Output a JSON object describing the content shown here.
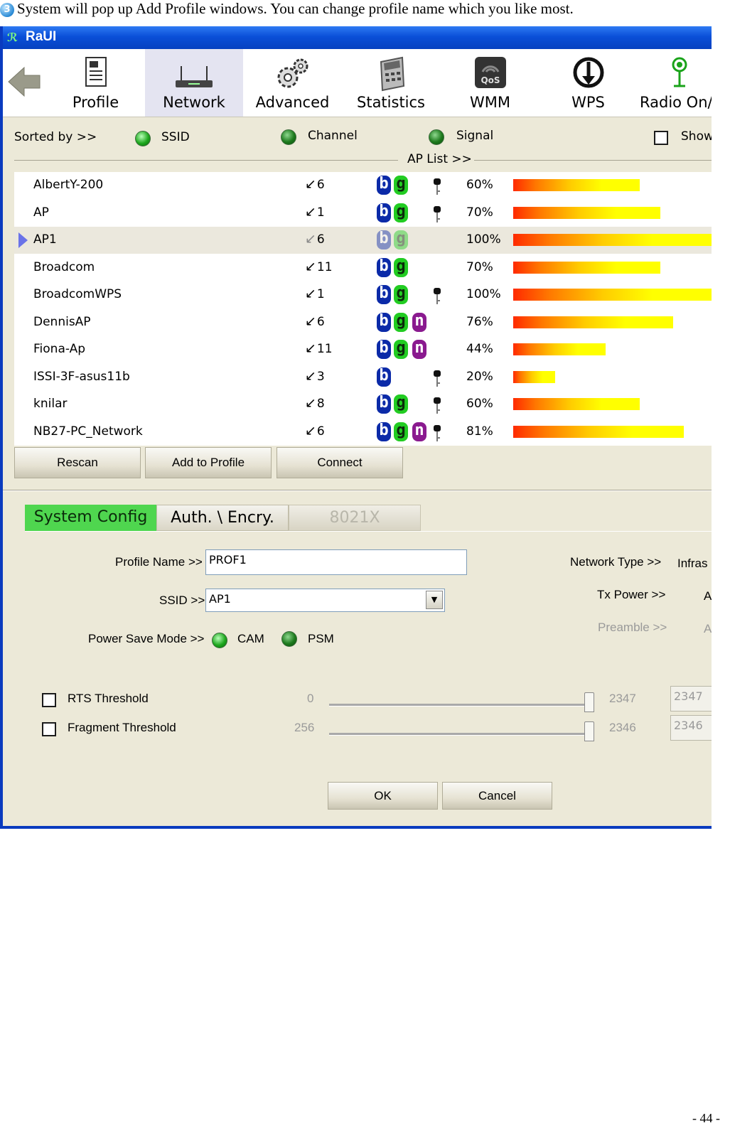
{
  "caption": {
    "step_number": "3",
    "text": "System will pop up Add Profile windows. You can change profile name which you like most."
  },
  "window": {
    "title": "RaUI"
  },
  "toolbar": {
    "items": [
      {
        "label": "Profile"
      },
      {
        "label": "Network"
      },
      {
        "label": "Advanced"
      },
      {
        "label": "Statistics"
      },
      {
        "label": "WMM"
      },
      {
        "label": "WPS"
      },
      {
        "label": "Radio On/"
      }
    ]
  },
  "sort": {
    "label": "Sorted by >>",
    "options": [
      "SSID",
      "Channel",
      "Signal"
    ],
    "show_label": "Show",
    "aplist_label": "AP List >>"
  },
  "aplist": [
    {
      "ssid": "AlbertY-200",
      "channel": "6",
      "modes": [
        "b",
        "g"
      ],
      "secure": true,
      "signal": "60%",
      "level": 0.6
    },
    {
      "ssid": "AP",
      "channel": "1",
      "modes": [
        "b",
        "g"
      ],
      "secure": true,
      "signal": "70%",
      "level": 0.7
    },
    {
      "ssid": "AP1",
      "channel": "6",
      "modes": [
        "b",
        "g"
      ],
      "secure": false,
      "signal": "100%",
      "level": 1.0,
      "selected": true
    },
    {
      "ssid": "Broadcom",
      "channel": "11",
      "modes": [
        "b",
        "g"
      ],
      "secure": false,
      "signal": "70%",
      "level": 0.7
    },
    {
      "ssid": "BroadcomWPS",
      "channel": "1",
      "modes": [
        "b",
        "g"
      ],
      "secure": true,
      "signal": "100%",
      "level": 1.0
    },
    {
      "ssid": "DennisAP",
      "channel": "6",
      "modes": [
        "b",
        "g",
        "n"
      ],
      "secure": false,
      "signal": "76%",
      "level": 0.76
    },
    {
      "ssid": "Fiona-Ap",
      "channel": "11",
      "modes": [
        "b",
        "g",
        "n"
      ],
      "secure": false,
      "signal": "44%",
      "level": 0.44
    },
    {
      "ssid": "ISSI-3F-asus11b",
      "channel": "3",
      "modes": [
        "b"
      ],
      "secure": true,
      "signal": "20%",
      "level": 0.2
    },
    {
      "ssid": "knilar",
      "channel": "8",
      "modes": [
        "b",
        "g"
      ],
      "secure": true,
      "signal": "60%",
      "level": 0.6
    },
    {
      "ssid": "NB27-PC_Network",
      "channel": "6",
      "modes": [
        "b",
        "g",
        "n"
      ],
      "secure": true,
      "signal": "81%",
      "level": 0.81
    }
  ],
  "buttons": {
    "rescan": "Rescan",
    "add_to_profile": "Add to Profile",
    "connect": "Connect",
    "ok": "OK",
    "cancel": "Cancel"
  },
  "tabs": [
    "System Config",
    "Auth. \\ Encry.",
    "8021X"
  ],
  "config": {
    "profile_name_label": "Profile Name >>",
    "profile_name": "PROF1",
    "ssid_label": "SSID >>",
    "ssid": "AP1",
    "power_save_label": "Power Save Mode >>",
    "power_options": [
      "CAM",
      "PSM"
    ],
    "network_type_label": "Network Type >>",
    "network_type": "Infras",
    "tx_power_label": "Tx Power >>",
    "tx_power": "A",
    "preamble_label": "Preamble >>",
    "preamble": "A",
    "rts_label": "RTS Threshold",
    "rts_min": "0",
    "rts_max": "2347",
    "rts_value": "2347",
    "frag_label": "Fragment Threshold",
    "frag_min": "256",
    "frag_max": "2346",
    "frag_value": "2346"
  },
  "page_number": "- 44 -"
}
